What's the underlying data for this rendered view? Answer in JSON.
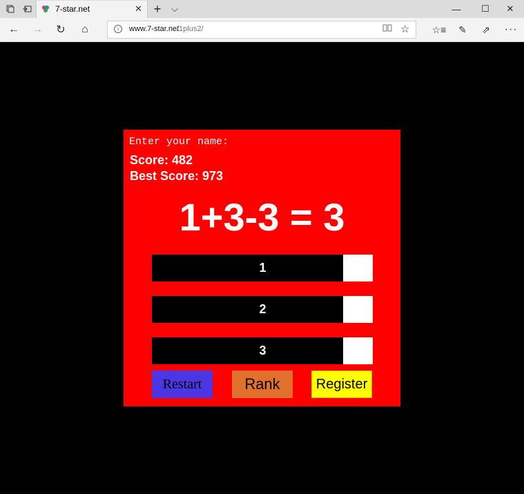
{
  "browser": {
    "tab_title": "7-star.net",
    "tab_close": "✕",
    "new_tab": "+",
    "tab_menu": "⌵",
    "win_min": "—",
    "win_max": "☐",
    "win_close": "✕",
    "back": "←",
    "forward": "→",
    "refresh": "↻",
    "home": "⌂",
    "address_domain": "www.7-star.net",
    "address_path": "/1plus2/",
    "reading_view": "📖",
    "favorite": "☆",
    "favorites_hub": "☆≡",
    "notes": "✎",
    "share": "⇗",
    "more": "···"
  },
  "game": {
    "name_label": "Enter your name:",
    "score_text": "Score: 482",
    "best_text": "Best Score: 973",
    "equation": "1+3-3 = 3",
    "options": [
      "1",
      "2",
      "3"
    ],
    "restart_label": "Restart",
    "rank_label": "Rank",
    "register_label": "Register"
  },
  "colors": {
    "panel": "#ff0000",
    "restart": "#4b36e3",
    "rank": "#e0702b",
    "register": "#ffff00"
  }
}
